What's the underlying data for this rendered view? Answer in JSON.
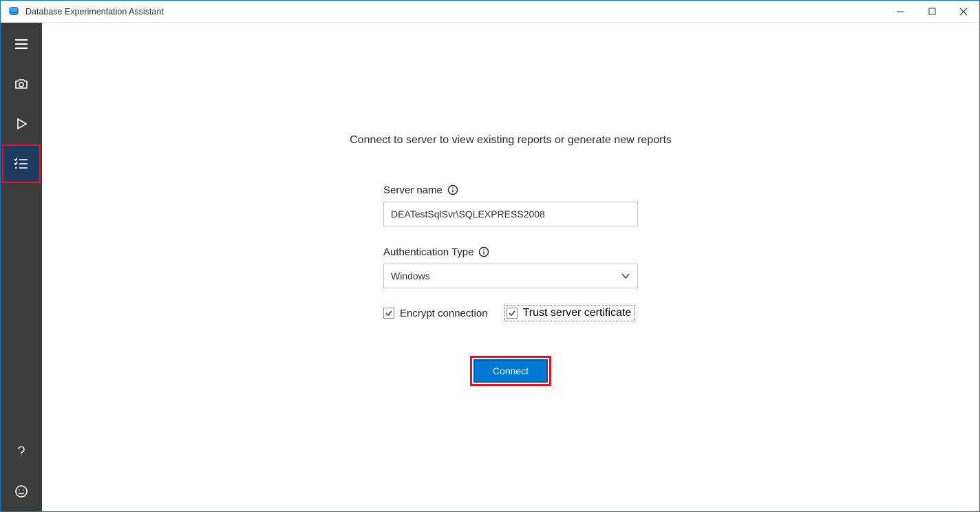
{
  "window": {
    "title": "Database Experimentation Assistant"
  },
  "main": {
    "hint": "Connect to server to view existing reports or generate new reports",
    "serverName": {
      "label": "Server name",
      "value": "DEATestSqlSvr\\SQLEXPRESS2008"
    },
    "authType": {
      "label": "Authentication Type",
      "selected": "Windows"
    },
    "encrypt": {
      "label": "Encrypt connection",
      "checked": true
    },
    "trust": {
      "label": "Trust server certificate",
      "checked": true
    },
    "connectLabel": "Connect"
  }
}
